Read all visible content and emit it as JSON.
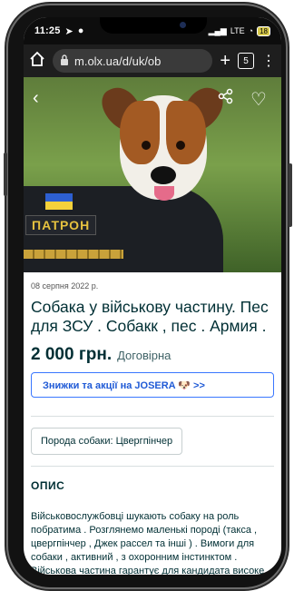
{
  "status_bar": {
    "time": "11:25",
    "network": "LTE",
    "battery": "18"
  },
  "browser": {
    "url": "m.olx.ua/d/uk/ob",
    "tab_count": "5"
  },
  "listing": {
    "photo_patch_text": "ПАТРОН",
    "date": "08 серпня 2022 р.",
    "title": "Собака у військову частину. Пес для ЗСУ . Собакк , пес . Армия .",
    "price": "2 000 грн.",
    "negotiable": "Договірна",
    "promo": "Знижки та акції на JOSERA 🐶 >>",
    "breed_tag": "Порода собаки: Цвергпінчер",
    "description_title": "ОПИС",
    "description": "Військовослужбовці шукають собаку на роль побратима . Розглянемо маленькі породі (такса , цвергпінчер , Джек рассел та інші ) . Вимоги для собаки , активний , з охоронним інстинктом . Військова частина гарантує для кандидата високе харчове забезпечення , багато уваги,"
  },
  "colors": {
    "olx_dark": "#002f34",
    "promo_blue": "#3a77ff",
    "flag_blue": "#2d5fd1",
    "flag_yellow": "#f4d13b"
  }
}
